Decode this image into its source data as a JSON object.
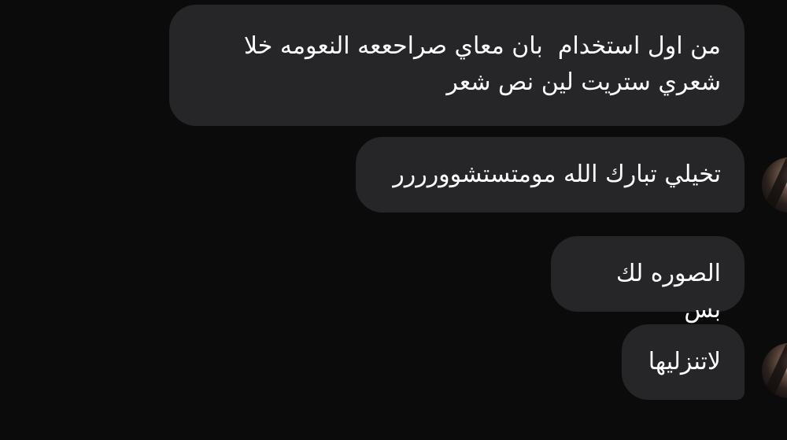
{
  "messages": [
    {
      "text": "من اول استخدام  بان معاي صراحععه النعومه خلا شعري ستريت لين نص شعر"
    },
    {
      "text": "تخيلي تبارك الله مومتستشوورررر"
    },
    {
      "text": "الصوره لك بس"
    },
    {
      "text": "لاتنزليها"
    }
  ],
  "avatar_icon": "user-avatar-icon",
  "colors": {
    "background": "#0b0b0c",
    "bubble": "#262628",
    "text": "#ffffff"
  }
}
